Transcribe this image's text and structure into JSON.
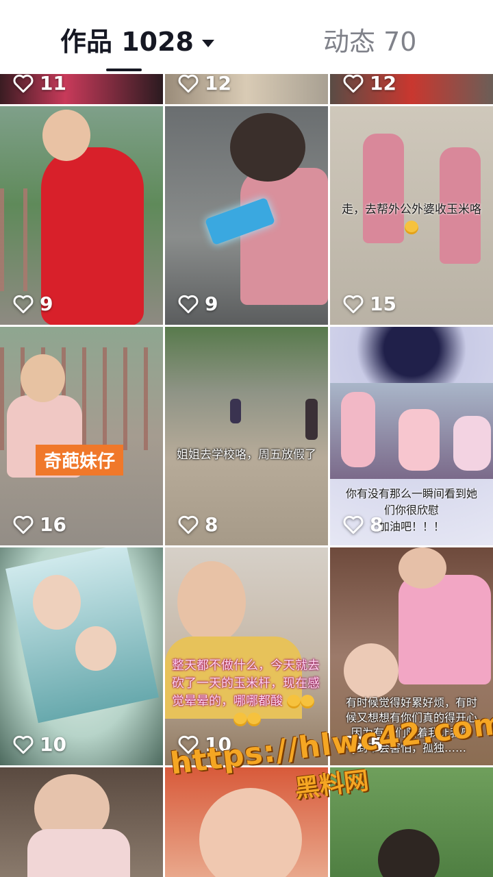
{
  "header": {
    "works_label": "作品 1028",
    "moments_label": "动态 70"
  },
  "grid": {
    "row0": [
      {
        "likes": "11"
      },
      {
        "likes": "12"
      },
      {
        "likes": "12"
      }
    ],
    "row1": [
      {
        "likes": "9"
      },
      {
        "likes": "9"
      },
      {
        "likes": "15",
        "caption": "走，去帮外公外婆收玉米咯"
      }
    ],
    "row2": [
      {
        "likes": "16",
        "tag": "奇葩妹仔"
      },
      {
        "likes": "8",
        "caption": "姐姐去学校咯，周五放假了"
      },
      {
        "likes": "8",
        "caption_line1": "你有没有那么一瞬间看到她",
        "caption_line2": "们你很欣慰",
        "caption_line3": "加油吧！！！"
      }
    ],
    "row3": [
      {
        "likes": "10"
      },
      {
        "likes": "10",
        "caption_line1": "整天都不做什么，今天就去",
        "caption_line2": "砍了一天的玉米杆，现在感",
        "caption_line3": "觉晕晕的，哪哪都酸"
      },
      {
        "likes": "5",
        "caption_line1": "有时候觉得好累好烦，有时",
        "caption_line2": "候又想想有你们真的得开心",
        "caption_line3": "因为有你们陪着我让我感",
        "caption_line4": "到不会害怕，孤独……"
      }
    ],
    "row4": [
      {},
      {},
      {}
    ]
  },
  "watermark": {
    "url": "https://hlwc42.com",
    "name": "黑料网"
  },
  "colors": {
    "tab_active": "#161823",
    "tab_inactive": "#80828a",
    "watermark": "#f5a623",
    "tag_orange": "#f0782a"
  }
}
